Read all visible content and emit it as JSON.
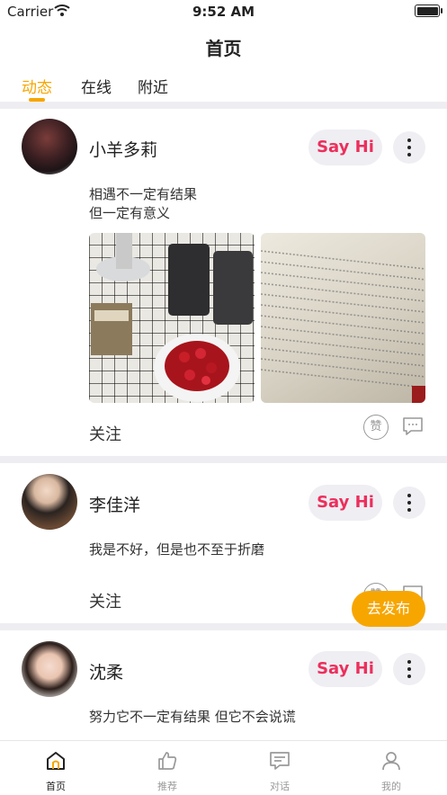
{
  "status_bar": {
    "carrier": "Carrier",
    "time": "9:52 AM",
    "battery_level": 1.0
  },
  "nav": {
    "title": "首页"
  },
  "tabs": [
    {
      "label": "动态",
      "active": true
    },
    {
      "label": "在线",
      "active": false
    },
    {
      "label": "附近",
      "active": false
    }
  ],
  "posts": [
    {
      "name": "小羊多莉",
      "say_hi": "Say Hi",
      "text_lines": [
        "相遇不一定有结果",
        "但一定有意义"
      ],
      "photos": [
        "desk-with-strawberries-photo",
        "open-book-pages-photo"
      ],
      "follow_label": "关注",
      "like_icon_text": "赞"
    },
    {
      "name": "李佳洋",
      "say_hi": "Say Hi",
      "text_lines": [
        "我是不好，但是也不至于折磨"
      ],
      "follow_label": "关注",
      "like_icon_text": "赞"
    },
    {
      "name": "沈柔",
      "say_hi": "Say Hi",
      "text_lines": [
        "努力它不一定有结果 但它不会说谎"
      ]
    }
  ],
  "publish_button": {
    "label": "去发布"
  },
  "tab_bar": [
    {
      "label": "首页",
      "icon": "home-icon",
      "active": true
    },
    {
      "label": "推荐",
      "icon": "thumbs-up-icon",
      "active": false
    },
    {
      "label": "对话",
      "icon": "chat-icon",
      "active": false
    },
    {
      "label": "我的",
      "icon": "person-icon",
      "active": false
    }
  ],
  "colors": {
    "accent": "#f7a600",
    "say_hi_text": "#ec2f5c",
    "chip_bg": "#efeef3",
    "separator": "#eeeef2"
  }
}
